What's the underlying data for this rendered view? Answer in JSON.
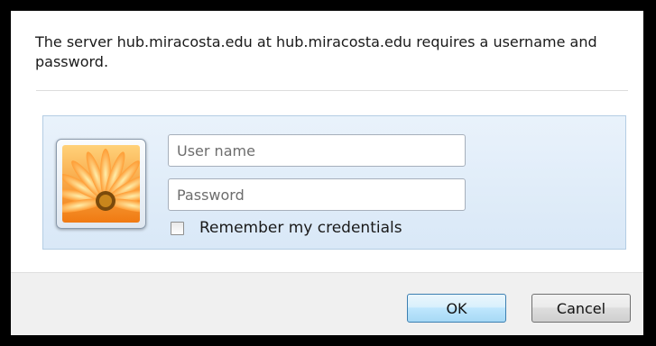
{
  "dialog": {
    "message": "The server hub.miracosta.edu at hub.miracosta.edu requires a username and password."
  },
  "credentials": {
    "username_placeholder": "User name",
    "username_value": "",
    "password_placeholder": "Password",
    "password_value": "",
    "remember_label": "Remember my credentials",
    "remember_checked": false,
    "user_tile_icon": "orange-flower-user-picture"
  },
  "buttons": {
    "ok_label": "OK",
    "cancel_label": "Cancel"
  },
  "colors": {
    "panel_background": "#dde9f6",
    "panel_border": "#b4cde4",
    "ok_button_border": "#3c7fb1",
    "footer_background": "#f0f0f0"
  }
}
